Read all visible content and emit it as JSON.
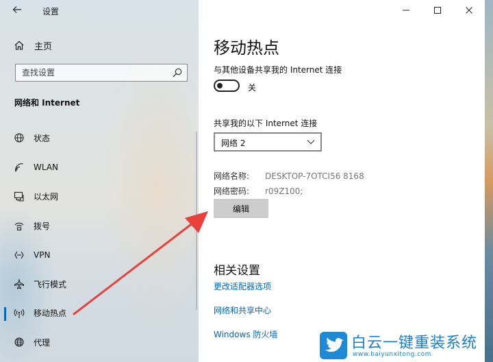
{
  "window": {
    "title": "设置"
  },
  "sidebar": {
    "home_label": "主页",
    "search_placeholder": "查找设置",
    "section_title": "网络和 Internet",
    "items": [
      {
        "label": "状态",
        "icon": "globe-status-icon"
      },
      {
        "label": "WLAN",
        "icon": "wifi-icon"
      },
      {
        "label": "以太网",
        "icon": "ethernet-icon"
      },
      {
        "label": "拨号",
        "icon": "dialup-icon"
      },
      {
        "label": "VPN",
        "icon": "vpn-icon"
      },
      {
        "label": "飞行模式",
        "icon": "airplane-icon"
      },
      {
        "label": "移动热点",
        "icon": "hotspot-icon",
        "active": true
      },
      {
        "label": "代理",
        "icon": "proxy-globe-icon"
      }
    ]
  },
  "main": {
    "title": "移动热点",
    "share_label": "与其他设备共享我的 Internet 连接",
    "toggle_state": "关",
    "connection_label": "共享我的以下 Internet 连接",
    "connection_value": "网络 2",
    "network_name_label": "网络名称:",
    "network_name_value": "DESKTOP-7OTCI56 8168",
    "network_password_label": "网络密码:",
    "network_password_value": "r09Z100;",
    "edit_button": "编辑",
    "related_title": "相关设置",
    "links": [
      "更改适配器选项",
      "网络和共享中心",
      "Windows 防火墙"
    ]
  },
  "watermark": {
    "brand": "白云一键重装系统",
    "url": "www.baiyunxitong.com"
  },
  "colors": {
    "accent": "#0067c0",
    "arrow": "#e8403a"
  }
}
